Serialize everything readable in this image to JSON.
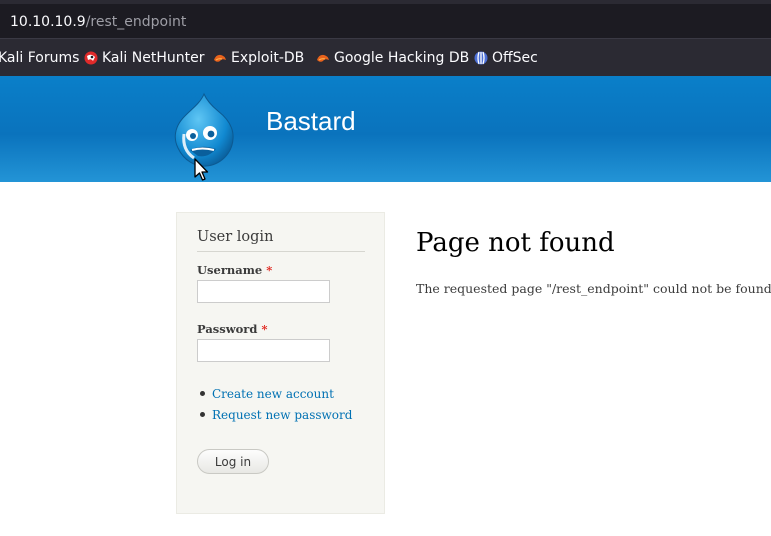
{
  "browser": {
    "url_host": "10.10.10.9",
    "url_path": "/rest_endpoint",
    "bookmarks": [
      {
        "label": "Kali Forums",
        "icon": "kali-forums-icon"
      },
      {
        "label": "Kali NetHunter",
        "icon": "nethunter-icon"
      },
      {
        "label": "Exploit-DB",
        "icon": "exploit-db-icon"
      },
      {
        "label": "Google Hacking DB",
        "icon": "ghdb-icon"
      },
      {
        "label": "OffSec",
        "icon": "offsec-icon"
      }
    ]
  },
  "site": {
    "name": "Bastard",
    "logo": "drupal-drop-logo",
    "header_color": "#0a77c2"
  },
  "login": {
    "title": "User login",
    "username_label": "Username",
    "password_label": "Password",
    "required_mark": "*",
    "links": [
      "Create new account",
      "Request new password"
    ],
    "submit_label": "Log in"
  },
  "content": {
    "title": "Page not found",
    "message": "The requested page \"/rest_endpoint\" could not be found."
  },
  "colors": {
    "link": "#0071b3",
    "required": "#e0271f",
    "sidebar_bg": "#f6f6f2"
  }
}
